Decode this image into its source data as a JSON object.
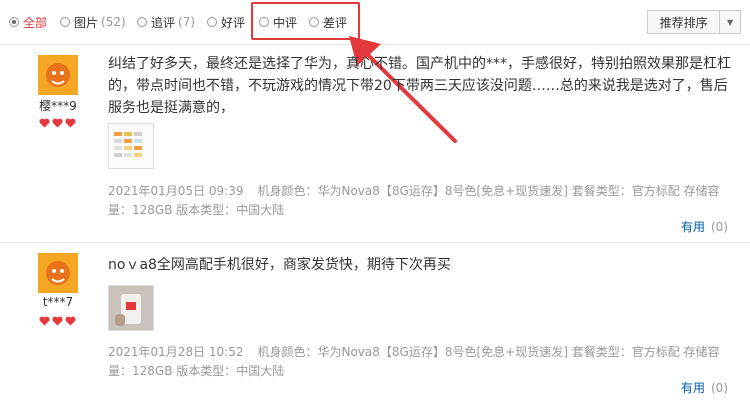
{
  "filters": [
    {
      "label": "全部",
      "count": "",
      "checked": true
    },
    {
      "label": "图片",
      "count": "(52)",
      "checked": false
    },
    {
      "label": "追评",
      "count": "(7)",
      "checked": false
    },
    {
      "label": "好评",
      "count": "",
      "checked": false
    },
    {
      "label": "中评",
      "count": "",
      "checked": false
    },
    {
      "label": "差评",
      "count": "",
      "checked": false
    }
  ],
  "sort": {
    "label": "推荐排序",
    "caret": "▼"
  },
  "colors": {
    "accent": "#e4393c",
    "link": "#005ea7",
    "meta": "#999999"
  },
  "reviews": [
    {
      "username": "樱***9",
      "content": "纠结了好多天，最终还是选择了华为，真心不错。国产机中的***，手感很好，特别拍照效果那是杠杠的，带点时间也不错，不玩游戏的情况下带20下带两三天应该没问题……总的来说我是选对了，售后服务也是挺满意的，",
      "date": "2021年01月05日 09:39",
      "meta": "机身颜色：华为Nova8【8G运存】8号色[免息+现货速发]   套餐类型：官方标配   存储容量：128GB   版本类型：中国大陆",
      "useful_label": "有用",
      "useful_count": "(0)"
    },
    {
      "username": "t***7",
      "content": "noｖa8全网高配手机很好，商家发货快，期待下次再买",
      "date": "2021年01月28日 10:52",
      "meta": "机身颜色：华为Nova8【8G运存】8号色[免息+现货速发]   套餐类型：官方标配   存储容量：128GB   版本类型：中国大陆",
      "useful_label": "有用",
      "useful_count": "(0)"
    }
  ]
}
